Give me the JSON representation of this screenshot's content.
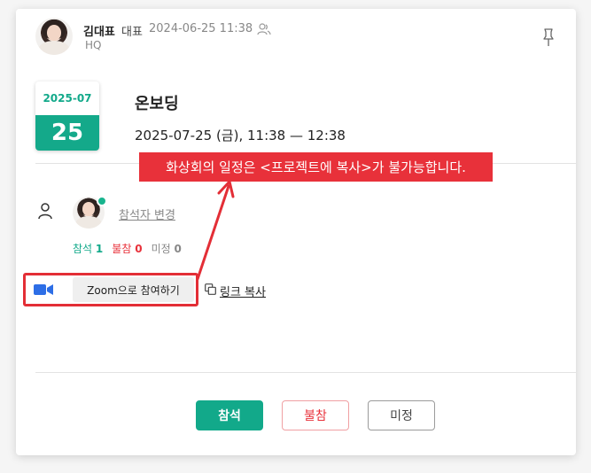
{
  "header": {
    "owner_name": "김대표",
    "owner_role": "대표",
    "datetime": "2024-06-25 11:38",
    "department": "HQ"
  },
  "event": {
    "date_year_month": "2025-07",
    "date_day": "25",
    "title": "온보딩",
    "time_range": "2025-07-25 (금), 11:38 — 12:38"
  },
  "callout": {
    "text": "화상회의 일정은 <프로젝트에 복사>가 불가능합니다."
  },
  "attendees": {
    "change_label": "참석자 변경",
    "counts": [
      {
        "label": "참석",
        "value": "1"
      },
      {
        "label": "불참",
        "value": "0"
      },
      {
        "label": "미정",
        "value": "0"
      }
    ]
  },
  "meeting": {
    "zoom_label": "Zoom으로 참여하기",
    "copy_link_label": "링크 복사"
  },
  "actions": {
    "attend_label": "참석",
    "decline_label": "불참",
    "undecided_label": "미정"
  },
  "colors": {
    "accent": "#12a98a",
    "danger": "#e8313a"
  }
}
